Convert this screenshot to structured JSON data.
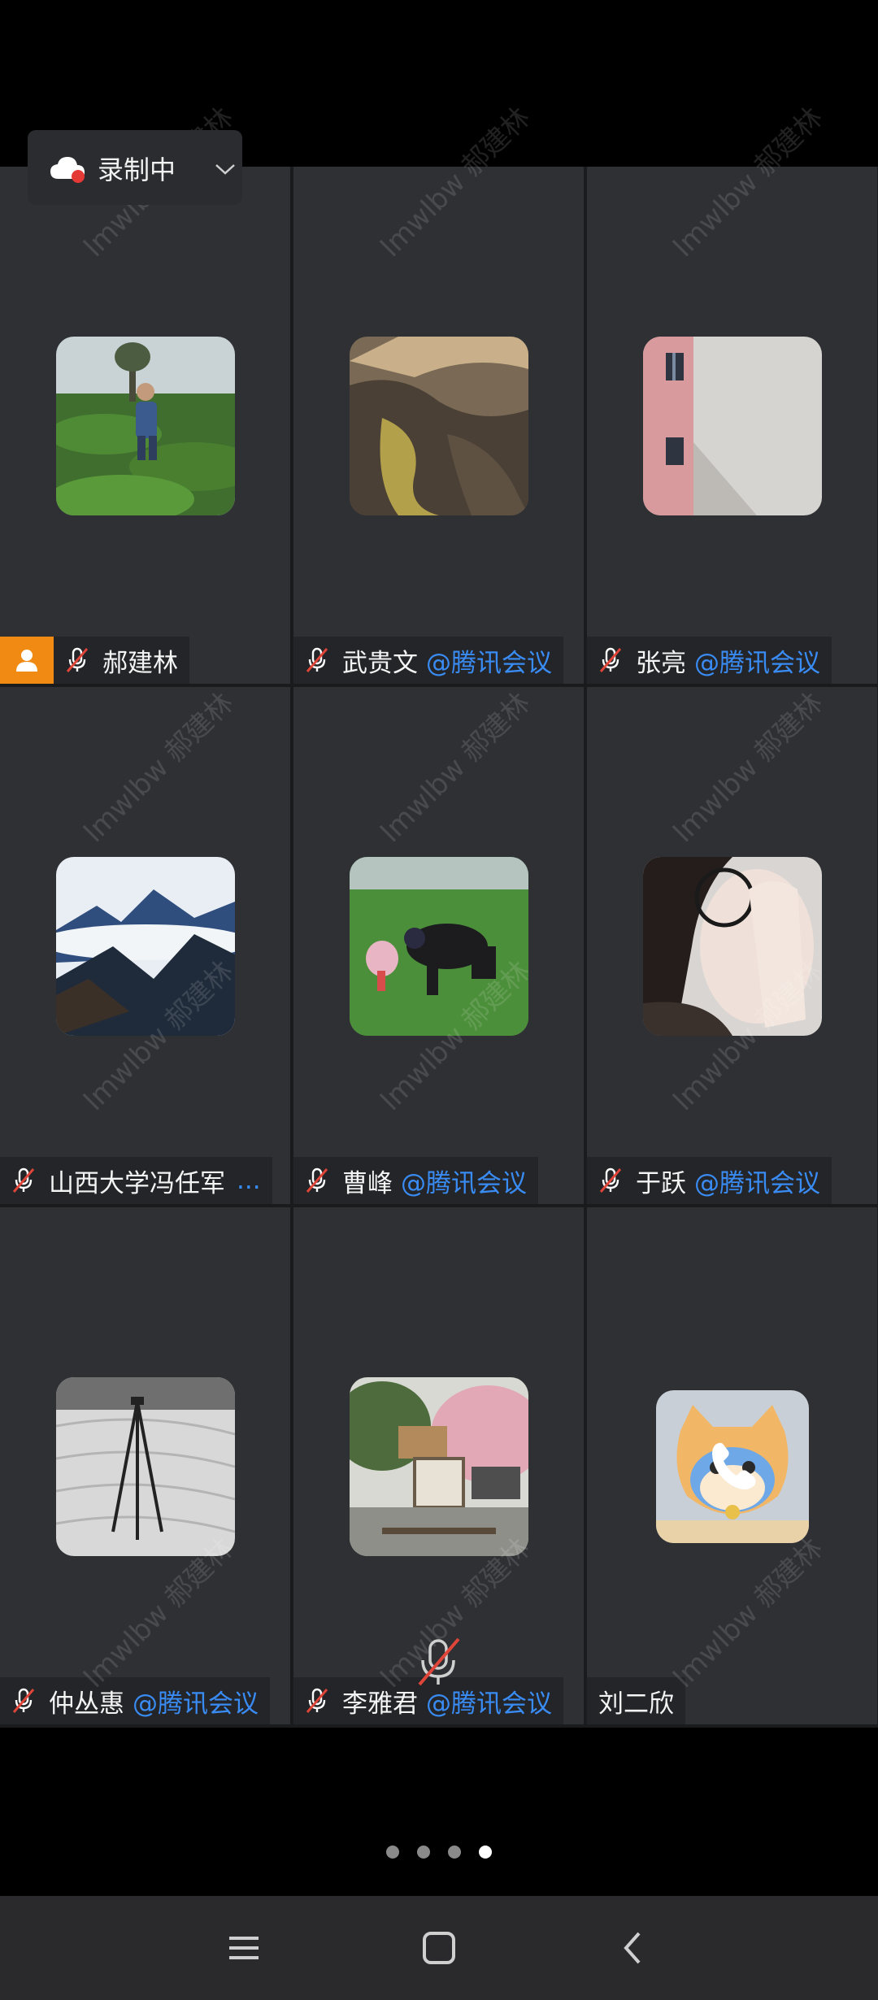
{
  "recording": {
    "label": "录制中"
  },
  "watermark_text": "lmwlbw 郝建林",
  "tiles": [
    {
      "name": "郝建林",
      "org": "",
      "host": true,
      "muted": true,
      "img": "tea-garden"
    },
    {
      "name": "武贵文",
      "org": "@腾讯会议",
      "host": false,
      "muted": true,
      "img": "mountain-valley"
    },
    {
      "name": "张亮",
      "org": "@腾讯会议",
      "host": false,
      "muted": true,
      "img": "wall-window"
    },
    {
      "name": "山西大学冯任军",
      "org": "...",
      "host": false,
      "muted": true,
      "img": "misty-mountains"
    },
    {
      "name": "曹峰",
      "org": "@腾讯会议",
      "host": false,
      "muted": true,
      "img": "family-grass"
    },
    {
      "name": "于跃",
      "org": "@腾讯会议",
      "host": false,
      "muted": true,
      "img": "glasses-portrait"
    },
    {
      "name": "仲丛惠",
      "org": "@腾讯会议",
      "host": false,
      "muted": true,
      "img": "tripod-desert"
    },
    {
      "name": "李雅君",
      "org": "@腾讯会议",
      "host": false,
      "muted": true,
      "img": "blossom-easel"
    },
    {
      "name": "刘二欣",
      "org": "",
      "host": false,
      "muted": false,
      "img": "cartoon-tiger",
      "phone": true
    }
  ],
  "pager": {
    "total": 4,
    "active": 4
  },
  "colors": {
    "accent": "#3a8cf5",
    "host": "#f08a12",
    "mute": "#e0453a"
  }
}
